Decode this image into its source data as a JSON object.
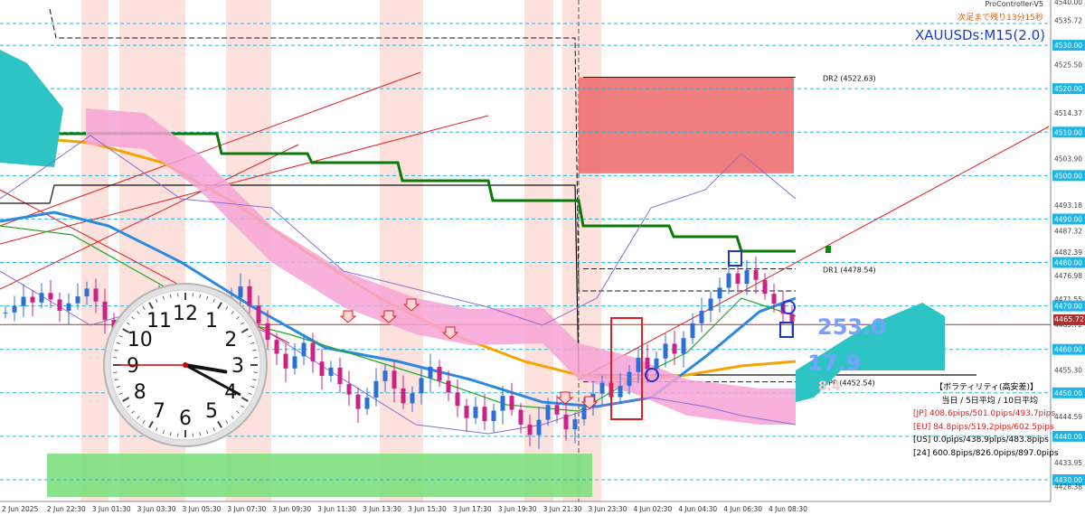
{
  "header": {
    "plugin": "ProController-V5",
    "countdown": "次足まで残り13分15秒",
    "symbol": "XAUUSDs:M15(2.0)"
  },
  "overlay": {
    "big1": "253.0",
    "big2": "17.9",
    "big3": "8.4"
  },
  "volatility": {
    "title": "【ボラティリティ(高安差)】",
    "subtitle": "当日 / 5日平均 / 10日平均",
    "rows": [
      {
        "text": "[JP] 408.6pips/501.0pips/493.7pips"
      },
      {
        "text": "[EU]  84.8pips/519.2pips/602.5pips"
      },
      {
        "text": "[US]   0.0pips/438.9pips/483.8pips"
      },
      {
        "text": "[24] 600.8pips/826.0pips/897.0pips"
      }
    ]
  },
  "clock": {
    "hours": 3,
    "minutes": 19,
    "seconds": 45
  },
  "colors": {
    "grid_cyan": "#1fb4e6",
    "sma_blue": "#2a8ae0",
    "kijun_orange": "#f5a500",
    "green_line": "#0a7a0a",
    "band_purple": "#8c6cd6",
    "cloud_pink": "#f7a3d6",
    "cloud_teal": "#2cc4c4",
    "bull_candle": "#2c6fd6",
    "bear_candle": "#cc2288"
  },
  "chart_data": {
    "type": "candlestick",
    "symbol": "XAUUSDs",
    "timeframe": "M15",
    "current_price": 4465.72,
    "current_price_label": "4465.72",
    "y_axis": {
      "range": [
        4425.0,
        4540.0
      ],
      "ticks": [
        "4540.00",
        "4535.72",
        "4530.00",
        "4525.50",
        "4520.00",
        "4514.37",
        "4510.00",
        "4503.90",
        "4500.00",
        "4493.18",
        "4490.00",
        "4487.32",
        "4482.39",
        "4480.00",
        "4476.98",
        "4471.55",
        "4470.00",
        "4465.72",
        "4460.00",
        "4455.30",
        "4450.00",
        "4444.59",
        "4440.00",
        "4433.95",
        "4430.00",
        "4428.38"
      ]
    },
    "x_axis": {
      "ticks": [
        "2 Jun 2025",
        "2 Jun 22:30",
        "3 Jun 01:30",
        "3 Jun 03:30",
        "3 Jun 05:30",
        "3 Jun 07:30",
        "3 Jun 09:30",
        "3 Jun 11:30",
        "3 Jun 13:30",
        "3 Jun 15:30",
        "3 Jun 17:30",
        "3 Jun 19:30",
        "3 Jun 21:30",
        "3 Jun 23:30",
        "4 Jun 02:30",
        "4 Jun 04:30",
        "4 Jun 06:30",
        "4 Jun 08:30"
      ]
    },
    "pivot_levels": [
      {
        "label": "DR2 (4522.63)",
        "value": 4522.63
      },
      {
        "label": "DR1 (4478.54)",
        "value": 4478.54
      },
      {
        "label": "DPP (4452.54)",
        "value": 4452.54
      }
    ],
    "horizontal_levels": [
      4535.0,
      4530.0,
      4520.0,
      4510.0,
      4500.0,
      4490.0,
      4480.0,
      4470.0,
      4460.0,
      4450.0,
      4440.0,
      4430.0
    ],
    "zones": [
      {
        "name": "resistance-zone",
        "from": 4500.5,
        "to": 4522.63,
        "color": "#ee7070"
      },
      {
        "name": "support-zone",
        "from": 4426.0,
        "to": 4436.0,
        "color": "#7de07d"
      }
    ],
    "candles_close": [
      4468.5,
      4470.0,
      4472.1,
      4470.8,
      4473.0,
      4471.5,
      4468.9,
      4470.6,
      4472.2,
      4474.0,
      4471.0,
      4466.8,
      4463.0,
      4458.2,
      4462.5,
      4466.4,
      4469.1,
      4471.8,
      4467.0,
      4464.1,
      4460.6,
      4463.8,
      4467.5,
      4465.0,
      4468.2,
      4471.9,
      4474.5,
      4470.1,
      4466.0,
      4462.2,
      4459.0,
      4455.6,
      4458.4,
      4461.5,
      4457.2,
      4453.9,
      4455.8,
      4452.0,
      4449.6,
      4446.3,
      4448.9,
      4452.7,
      4455.1,
      4451.0,
      4447.6,
      4449.9,
      4453.4,
      4456.0,
      4452.8,
      4450.1,
      4447.0,
      4444.2,
      4446.8,
      4443.5,
      4445.9,
      4449.3,
      4446.1,
      4442.7,
      4440.3,
      4443.8,
      4447.2,
      4445.0,
      4441.6,
      4443.9,
      4446.7,
      4449.8,
      4452.3,
      4449.0,
      4451.6,
      4454.8,
      4458.1,
      4455.5,
      4457.9,
      4461.3,
      4459.0,
      4462.6,
      4466.0,
      4468.9,
      4471.7,
      4474.2,
      4477.5,
      4475.1,
      4478.3,
      4476.0,
      4472.8,
      4470.5,
      4468.2,
      4466.4
    ]
  }
}
